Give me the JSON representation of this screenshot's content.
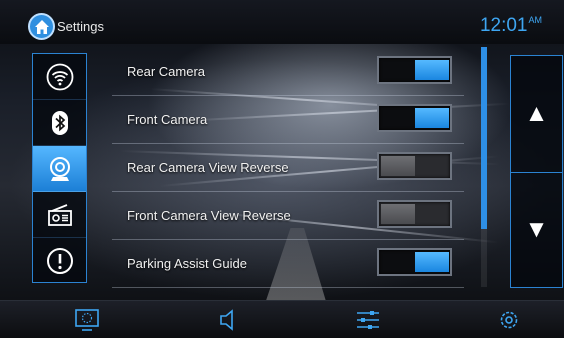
{
  "header": {
    "title": "Settings",
    "clock_time": "12:01",
    "clock_ampm": "AM"
  },
  "sidebar": {
    "items": [
      {
        "icon": "wifi-icon",
        "active": false
      },
      {
        "icon": "bluetooth-icon",
        "active": false
      },
      {
        "icon": "camera-icon",
        "active": true
      },
      {
        "icon": "radio-icon",
        "active": false
      },
      {
        "icon": "info-alert-icon",
        "active": false
      }
    ]
  },
  "settings": {
    "rows": [
      {
        "label": "Rear Camera",
        "enabled": true
      },
      {
        "label": "Front Camera",
        "enabled": true
      },
      {
        "label": "Rear Camera View Reverse",
        "enabled": false
      },
      {
        "label": "Front Camera View Reverse",
        "enabled": false
      },
      {
        "label": "Parking Assist Guide",
        "enabled": true
      }
    ],
    "scroll_position": 0.0,
    "scroll_visible_fraction": 0.76
  },
  "scroll_buttons": {
    "up_glyph": "▲",
    "down_glyph": "▼"
  },
  "bottom_bar": {
    "items": [
      "screen-icon",
      "speaker-icon",
      "equalizer-icon",
      "settings-gear-icon"
    ]
  },
  "colors": {
    "accent": "#2e8fe6",
    "toggle_on": "#1a86e0",
    "toggle_off": "#5a5b5f",
    "clock": "#3ea6f2"
  }
}
